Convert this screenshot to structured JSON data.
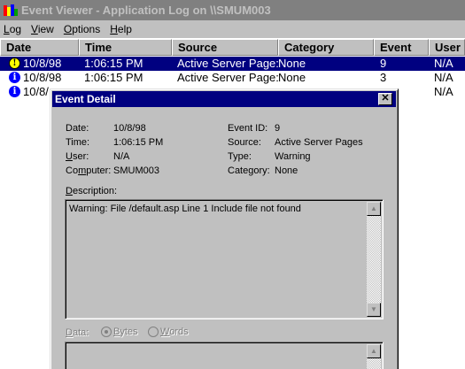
{
  "window": {
    "title": "Event Viewer - Application Log on \\\\SMUM003"
  },
  "menu": [
    {
      "prefix": "",
      "key": "L",
      "rest": "og"
    },
    {
      "prefix": "",
      "key": "V",
      "rest": "iew"
    },
    {
      "prefix": "",
      "key": "O",
      "rest": "ptions"
    },
    {
      "prefix": "",
      "key": "H",
      "rest": "elp"
    }
  ],
  "columns": [
    "Date",
    "Time",
    "Source",
    "Category",
    "Event",
    "User"
  ],
  "rows": [
    {
      "icon": "warning-icon",
      "date": "10/8/98",
      "time": "1:06:15 PM",
      "source": "Active Server Page:",
      "category": "None",
      "event": "9",
      "user": "N/A"
    },
    {
      "icon": "info-icon",
      "date": "10/8/98",
      "time": "1:06:15 PM",
      "source": "Active Server Page:",
      "category": "None",
      "event": "3",
      "user": "N/A"
    },
    {
      "icon": "info-icon",
      "date": "10/8/",
      "time": "",
      "source": "",
      "category": "",
      "event": "",
      "user": "N/A"
    }
  ],
  "dialog": {
    "title": "Event Detail",
    "close_glyph": "✕",
    "date_label": "Date:",
    "date_value": "10/8/98",
    "time_label": "Time:",
    "time_value": "1:06:15 PM",
    "user_label_key": "U",
    "user_label_rest": "ser:",
    "user_value": "N/A",
    "computer_label_pre": "Co",
    "computer_label_key": "m",
    "computer_label_rest": "puter:",
    "computer_value": "SMUM003",
    "eventid_label": "Event ID:",
    "eventid_value": "9",
    "source_label": "Source:",
    "source_value": "Active Server Pages",
    "type_label": "Type:",
    "type_value": "Warning",
    "category_label": "Category:",
    "category_value": "None",
    "description_label_key": "D",
    "description_label_rest": "escription:",
    "description_text": "Warning: File /default.asp Line 1 Include file not found",
    "data_label_key": "D",
    "data_label_rest": "ata:",
    "bytes_label_key": "B",
    "bytes_label_rest": "ytes",
    "words_label_key": "W",
    "words_label_rest": "ords"
  }
}
